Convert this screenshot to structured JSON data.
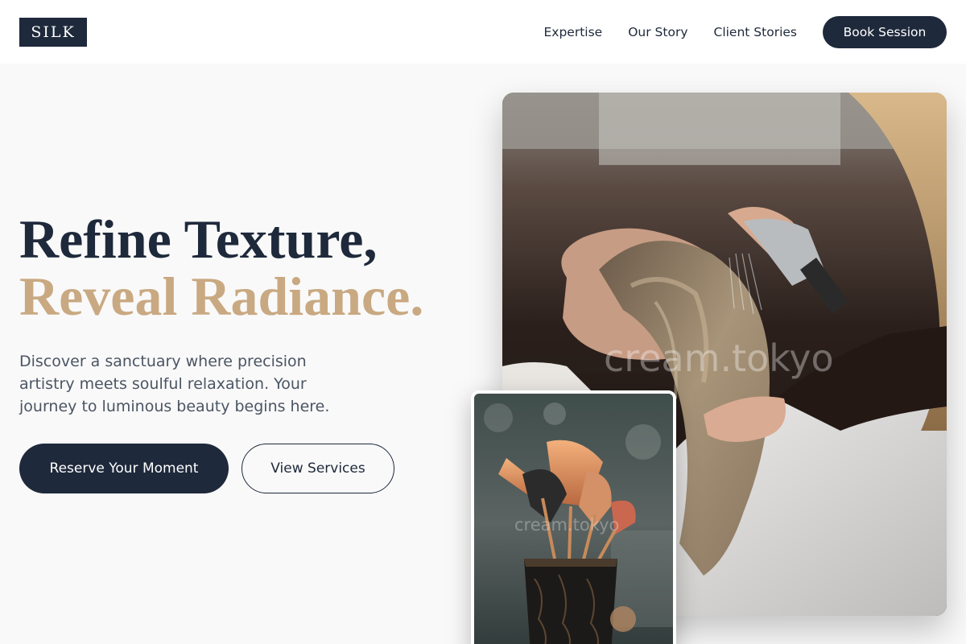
{
  "header": {
    "logo": "SILK",
    "nav": [
      {
        "label": "Expertise"
      },
      {
        "label": "Our Story"
      },
      {
        "label": "Client Stories"
      }
    ],
    "cta_label": "Book Session"
  },
  "hero": {
    "headline_line1": "Refine Texture,",
    "headline_line2": "Reveal Radiance.",
    "description": "Discover a sanctuary where precision artistry meets soulful relaxation. Your journey to luminous beauty begins here.",
    "primary_button": "Reserve Your Moment",
    "secondary_button": "View Services"
  },
  "images": {
    "main_photo": {
      "watermark": "cream.tokyo"
    },
    "small_photo": {
      "watermark": "cream.tokyo"
    }
  },
  "colors": {
    "navy": "#1e293b",
    "gold": "#c9a982",
    "page_bg": "#f9f9f9",
    "text_muted": "#4b5563"
  },
  "icons": []
}
